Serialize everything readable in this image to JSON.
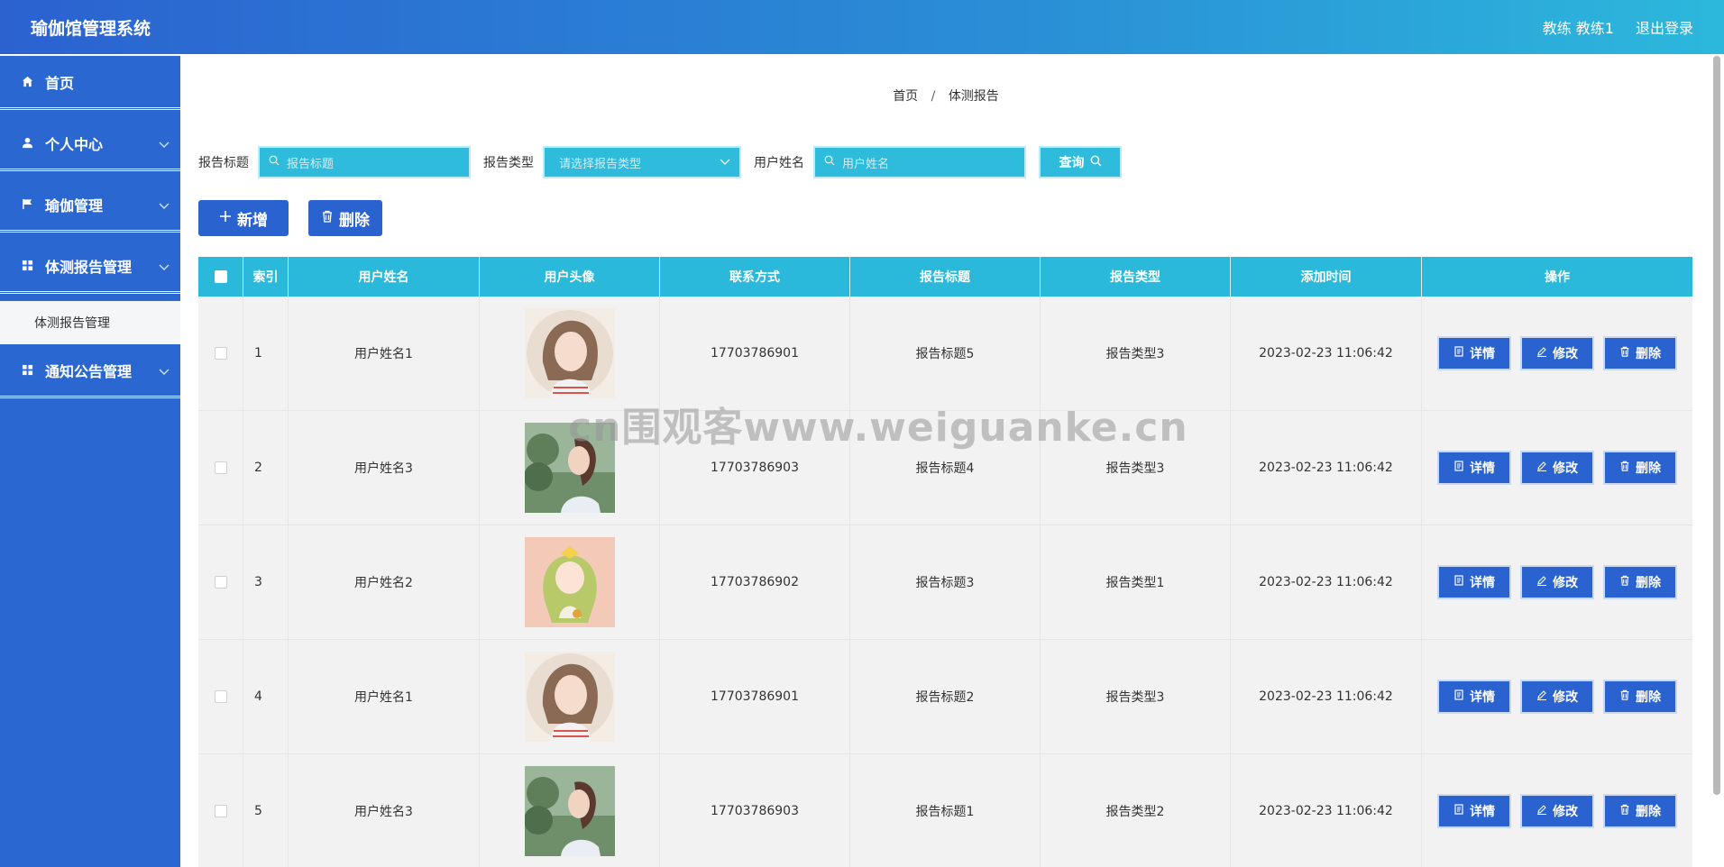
{
  "header": {
    "app_title": "瑜伽馆管理系统",
    "user": "教练 教练1",
    "logout": "退出登录"
  },
  "sidebar": {
    "items": [
      {
        "label": "首页",
        "icon": "home-icon"
      },
      {
        "label": "个人中心",
        "icon": "user-icon"
      },
      {
        "label": "瑜伽管理",
        "icon": "flag-icon"
      },
      {
        "label": "体测报告管理",
        "icon": "grid-icon"
      },
      {
        "label": "通知公告管理",
        "icon": "grid-icon"
      }
    ],
    "submenu": {
      "label": "体测报告管理"
    }
  },
  "breadcrumb": {
    "home": "首页",
    "sep": "/",
    "current": "体测报告"
  },
  "search": {
    "title_label": "报告标题",
    "title_placeholder": "报告标题",
    "type_label": "报告类型",
    "type_placeholder": "请选择报告类型",
    "name_label": "用户姓名",
    "name_placeholder": "用户姓名",
    "query_label": "查询"
  },
  "actions": {
    "add_label": "新增",
    "delete_label": "删除"
  },
  "table": {
    "headers": [
      "索引",
      "用户姓名",
      "用户头像",
      "联系方式",
      "报告标题",
      "报告类型",
      "添加时间",
      "操作"
    ],
    "rows": [
      {
        "idx": "1",
        "name": "用户姓名1",
        "phone": "17703786901",
        "title": "报告标题5",
        "type": "报告类型3",
        "time": "2023-02-23 11:06:42"
      },
      {
        "idx": "2",
        "name": "用户姓名3",
        "phone": "17703786903",
        "title": "报告标题4",
        "type": "报告类型3",
        "time": "2023-02-23 11:06:42"
      },
      {
        "idx": "3",
        "name": "用户姓名2",
        "phone": "17703786902",
        "title": "报告标题3",
        "type": "报告类型1",
        "time": "2023-02-23 11:06:42"
      },
      {
        "idx": "4",
        "name": "用户姓名1",
        "phone": "17703786901",
        "title": "报告标题2",
        "type": "报告类型3",
        "time": "2023-02-23 11:06:42"
      },
      {
        "idx": "5",
        "name": "用户姓名3",
        "phone": "17703786903",
        "title": "报告标题1",
        "type": "报告类型2",
        "time": "2023-02-23 11:06:42"
      }
    ],
    "op_labels": {
      "detail": "详情",
      "edit": "修改",
      "delete": "删除"
    }
  },
  "watermark": "cn围观客www.weiguanke.cn",
  "colors": {
    "header_start": "#2b62d0",
    "header_end": "#2cb8dc",
    "sidebar": "#2a67d0",
    "table_head": "#2ab8db",
    "primary_button": "#2a63cf"
  }
}
